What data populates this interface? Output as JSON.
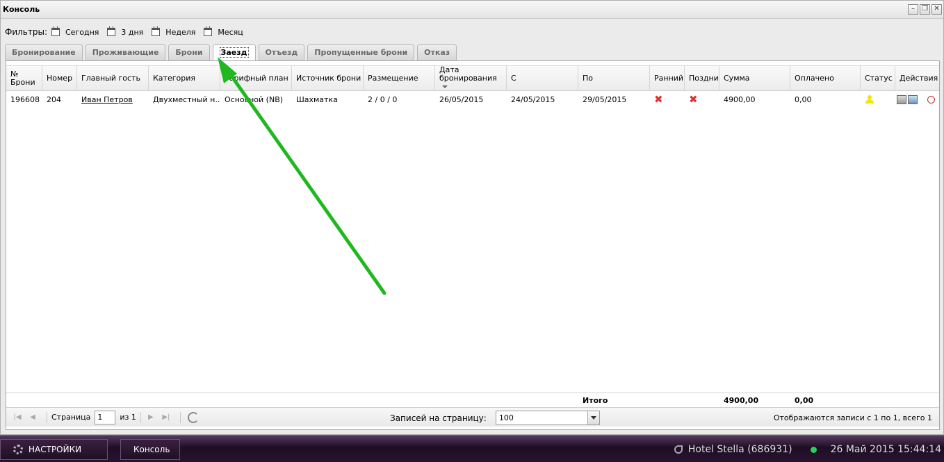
{
  "window": {
    "title": "Консоль"
  },
  "filters": {
    "label": "Фильтры:",
    "items": [
      "Сегодня",
      "3 дня",
      "Неделя",
      "Месяц"
    ]
  },
  "tabs": [
    {
      "label": "Бронирование"
    },
    {
      "label": "Проживающие"
    },
    {
      "label": "Брони"
    },
    {
      "label": "Заезд",
      "active": true
    },
    {
      "label": "Отъезд"
    },
    {
      "label": "Пропущенные брони"
    },
    {
      "label": "Отказ"
    }
  ],
  "grid": {
    "columns": [
      "№ Брони",
      "Номер",
      "Главный гость",
      "Категория",
      "Тарифный план",
      "Источник брони",
      "Размещение",
      "Дата бронирования",
      "С",
      "По",
      "Ранний з",
      "Поздний",
      "Сумма",
      "Оплачено",
      "Статус",
      "Действия"
    ],
    "row": {
      "id": "196608",
      "room": "204",
      "guest": "Иван Петров",
      "category": "Двухместный н...",
      "rate": "Основной (NB)",
      "source": "Шахматка",
      "placement": "2 / 0 / 0",
      "booked": "26/05/2015",
      "from": "24/05/2015",
      "to": "29/05/2015",
      "early_icon": "x-icon",
      "late_icon": "x-icon",
      "sum": "4900,00",
      "paid": "0,00",
      "status_icon": "person-icon"
    },
    "totals": {
      "label": "Итого",
      "sum": "4900,00",
      "paid": "0,00"
    }
  },
  "pager": {
    "page_label": "Страница",
    "page_value": "1",
    "of_label": "из 1",
    "rpp_label": "Записей на страницу:",
    "rpp_value": "100",
    "display_info": "Отображаются записи с 1 по 1, всего 1"
  },
  "taskbar": {
    "settings": "НАСТРОЙКИ",
    "console": "Консоль",
    "hotel": "Hotel Stella (686931)",
    "datetime": "26 Май 2015 15:44:14"
  },
  "colors": {
    "arrow": "#1fb81f",
    "status_online": "#23d35a"
  }
}
